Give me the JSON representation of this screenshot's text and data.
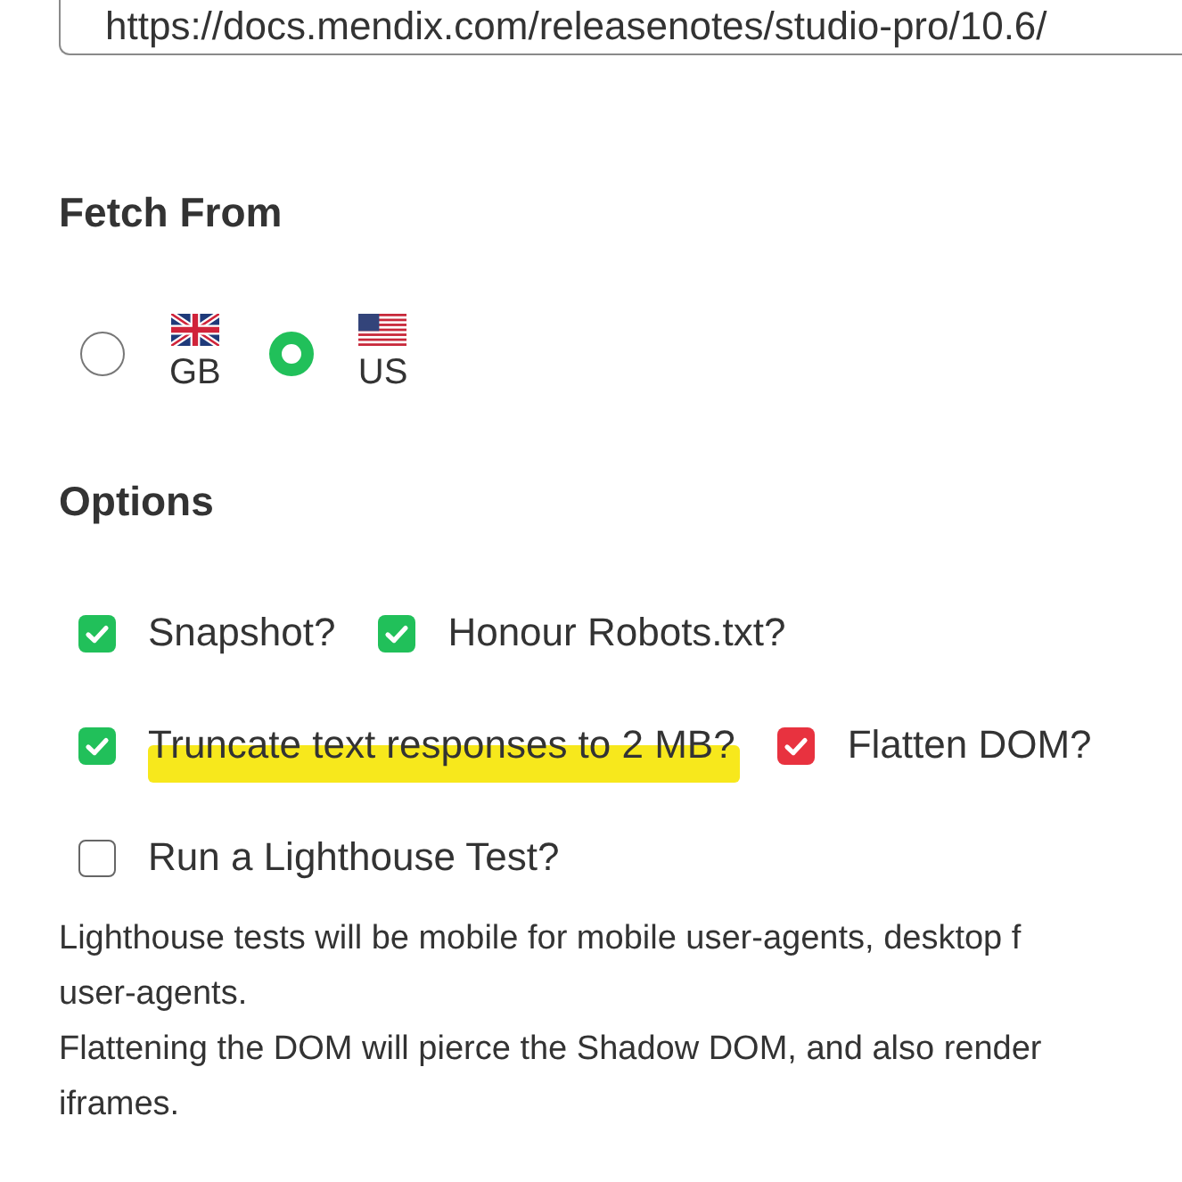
{
  "url_field": {
    "value": "https://docs.mendix.com/releasenotes/studio-pro/10.6/"
  },
  "fetch_from": {
    "heading": "Fetch From",
    "options": [
      {
        "kind": "gb",
        "label": "GB",
        "selected": false
      },
      {
        "kind": "us",
        "label": "US",
        "selected": true
      }
    ]
  },
  "options": {
    "heading": "Options",
    "rows": [
      {
        "items": [
          {
            "label": "Snapshot?",
            "checked": true,
            "color": "#21c05a",
            "highlighted": false
          },
          {
            "label": "Honour Robots.txt?",
            "checked": true,
            "color": "#21c05a",
            "highlighted": false
          }
        ]
      },
      {
        "items": [
          {
            "label": "Truncate text responses to 2 MB?",
            "checked": true,
            "color": "#21c05a",
            "highlighted": true
          },
          {
            "label": "Flatten DOM?",
            "checked": true,
            "color": "#e8323f",
            "highlighted": false
          }
        ]
      },
      {
        "items": [
          {
            "label": "Run a Lighthouse Test?",
            "checked": false,
            "highlighted": false
          }
        ]
      }
    ]
  },
  "notes": [
    {
      "lines": [
        "Lighthouse tests will be mobile for mobile user-agents, desktop f",
        "user-agents."
      ]
    },
    {
      "lines": [
        "Flattening the DOM will pierce the Shadow DOM, and also render",
        "iframes."
      ]
    }
  ]
}
